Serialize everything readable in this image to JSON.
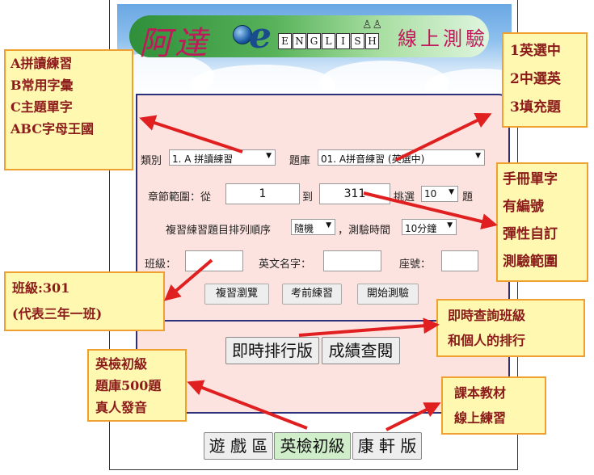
{
  "banner": {
    "logo_name": "阿達",
    "logo_e": "e",
    "logo_letters": [
      "E",
      "N",
      "G",
      "L",
      "I",
      "S",
      "H"
    ],
    "logo_subtitle": "線上測驗"
  },
  "form": {
    "category_label": "類別",
    "category_value": "1. A 拼讀練習",
    "bank_label": "題庫",
    "bank_value": "01. A拼音練習 (英選中)",
    "range_label": "章節範圍：從",
    "range_from": "1",
    "range_to_label": "到",
    "range_to": "311",
    "pick_label": "挑選",
    "pick_value": "10",
    "pick_unit": "題",
    "order_label": "複習練習題目排列順序",
    "order_value": "隨機",
    "time_label": "，測驗時間",
    "time_value": "10分鐘",
    "class_label": "班級：",
    "name_label": "英文名字：",
    "seat_label": "座號：",
    "btn_review": "複習瀏覽",
    "btn_practice": "考前練習",
    "btn_start": "開始測驗",
    "btn_ranking": "即時排行版",
    "btn_scores": "成績查閱",
    "btn_games": "遊 戲 區",
    "btn_gept": "英檢初級",
    "btn_kangxuan": "康 軒 版"
  },
  "callouts": {
    "categories": [
      "A拼讀練習",
      "B常用字彙",
      "C主題單字",
      "ABC字母王國"
    ],
    "modes": [
      "1英選中",
      "2中選英",
      "3填充題"
    ],
    "manual": [
      "手冊單字",
      "有編號",
      "彈性自訂",
      "測驗範圍"
    ],
    "class": [
      "班級:301",
      "(代表三年一班)"
    ],
    "ranking": [
      "即時查詢班級",
      "和個人的排行"
    ],
    "gept": [
      "英檢初級",
      "題庫500題",
      "真人發音"
    ],
    "textbook": [
      "課本教材",
      "線上練習"
    ]
  },
  "colors": {
    "callout_bg": "#fff8b0",
    "callout_border": "#f0a030",
    "callout_text": "#8b1a1a",
    "arrow": "#e02020",
    "form_bg": "#fde3df",
    "form_border": "#2c2f7a"
  }
}
